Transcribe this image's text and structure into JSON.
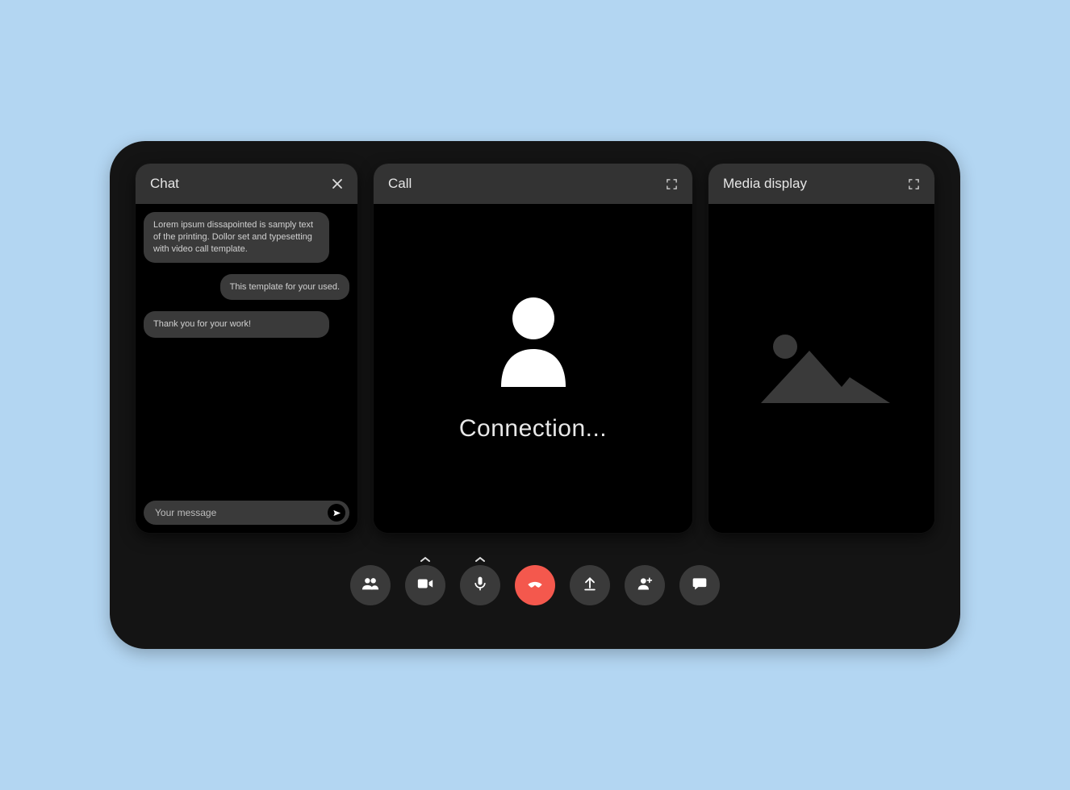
{
  "chat": {
    "title": "Chat",
    "messages": [
      {
        "text": "Lorem ipsum dissapointed is samply text of the printing. Dollor set and typesetting with video call template.",
        "align": "left"
      },
      {
        "text": "This template for your used.",
        "align": "right"
      },
      {
        "text": "Thank you for your work!",
        "align": "left"
      }
    ],
    "input_placeholder": "Your message"
  },
  "call": {
    "title": "Call",
    "status": "Connection..."
  },
  "media": {
    "title": "Media display"
  },
  "toolbar": {
    "buttons": [
      {
        "name": "participants",
        "icon": "people",
        "caret": false,
        "hangup": false
      },
      {
        "name": "camera",
        "icon": "video",
        "caret": true,
        "hangup": false
      },
      {
        "name": "microphone",
        "icon": "mic",
        "caret": true,
        "hangup": false
      },
      {
        "name": "hangup",
        "icon": "phone",
        "caret": false,
        "hangup": true
      },
      {
        "name": "share",
        "icon": "upload",
        "caret": false,
        "hangup": false
      },
      {
        "name": "add-user",
        "icon": "adduser",
        "caret": false,
        "hangup": false
      },
      {
        "name": "chat",
        "icon": "chat",
        "caret": false,
        "hangup": false
      }
    ]
  },
  "colors": {
    "page_bg": "#b3d6f2",
    "device_bg": "#141414",
    "panel_header": "#333333",
    "bubble": "#3a3a3a",
    "hangup": "#f4584d"
  }
}
